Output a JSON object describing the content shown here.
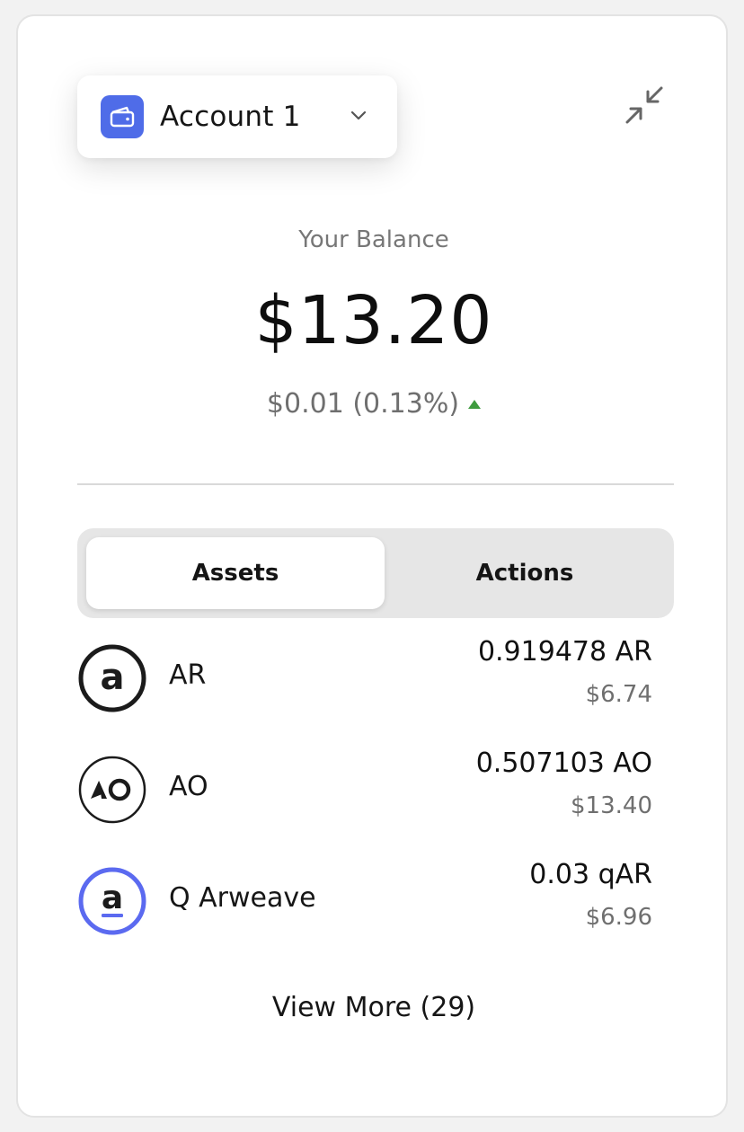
{
  "account": {
    "name": "Account 1",
    "icon": "wallet-icon",
    "dropdown_icon": "chevron-down-icon"
  },
  "header": {
    "collapse_icon": "collapse-icon"
  },
  "balance": {
    "label": "Your Balance",
    "value": "$13.20",
    "change": "$0.01 (0.13%)",
    "change_direction": "up",
    "change_color": "#3f9b3f"
  },
  "tabs": [
    {
      "label": "Assets",
      "active": true
    },
    {
      "label": "Actions",
      "active": false
    }
  ],
  "assets": [
    {
      "name": "AR",
      "amount": "0.919478 AR",
      "usd": "$6.74",
      "icon": "arweave-logo-icon"
    },
    {
      "name": "AO",
      "amount": "0.507103 AO",
      "usd": "$13.40",
      "icon": "ao-logo-icon"
    },
    {
      "name": "Q Arweave",
      "amount": "0.03 qAR",
      "usd": "$6.96",
      "icon": "q-arweave-logo-icon"
    }
  ],
  "view_more": "View More (29)",
  "colors": {
    "accent": "#4f6ce8",
    "positive": "#3f9b3f",
    "q_ring": "#5b6af0"
  }
}
